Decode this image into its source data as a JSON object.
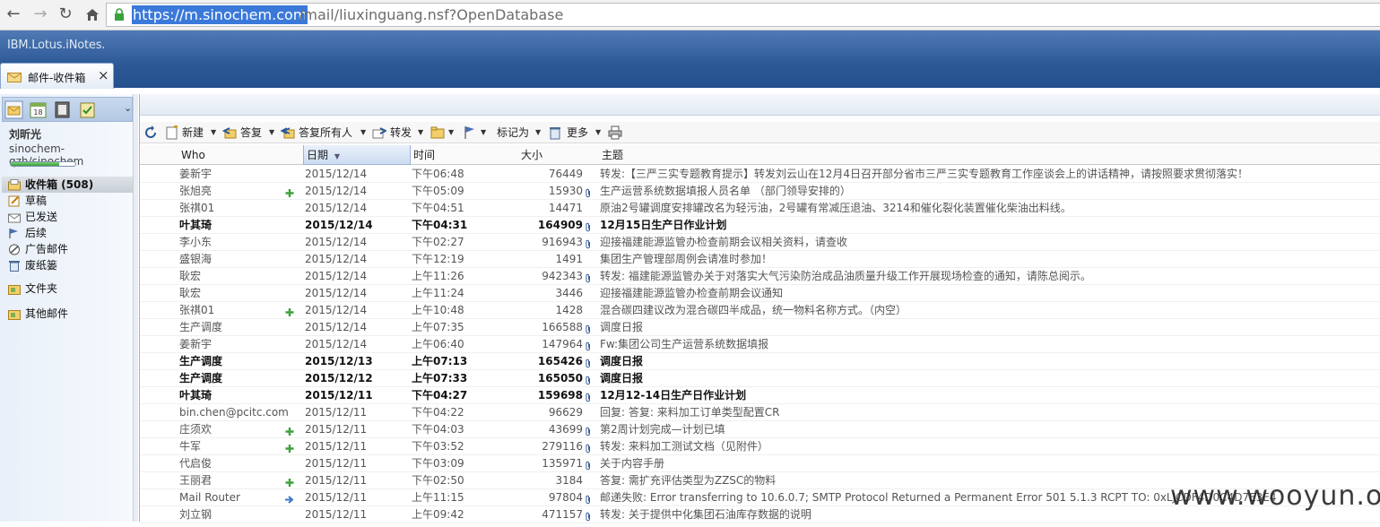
{
  "browser": {
    "url_host": "https://m.sinochem.com",
    "url_path": "/mail/liuxinguang.nsf?OpenDatabase"
  },
  "app": {
    "brand": "IBM.Lotus.iNotes.",
    "tab_label": "邮件-收件箱"
  },
  "user": {
    "name": "刘昕光",
    "mail_id": "sinochem-qzh/sinochem",
    "quota_fraction": 0.75
  },
  "folders": [
    {
      "label": "收件箱 (508)",
      "icon": "inbox-icon"
    },
    {
      "label": "草稿",
      "icon": "drafts-icon"
    },
    {
      "label": "已发送",
      "icon": "sent-icon"
    },
    {
      "label": "后续",
      "icon": "follow-up-flag-icon"
    },
    {
      "label": "广告邮件",
      "icon": "junk-icon"
    },
    {
      "label": "废纸篓",
      "icon": "trash-icon"
    },
    {
      "label": "文件夹",
      "icon": "folders-icon"
    },
    {
      "label": "其他邮件",
      "icon": "other-mail-icon"
    }
  ],
  "toolbar": {
    "new": "新建",
    "reply": "答复",
    "reply_all": "答复所有人",
    "forward": "转发",
    "mark_as": "标记为",
    "more": "更多"
  },
  "columns": {
    "who": "Who",
    "date": "日期",
    "time": "时间",
    "size": "大小",
    "subject": "主题"
  },
  "messages": [
    {
      "who": "姜新宇",
      "date": "2015/12/14",
      "time": "下午06:48",
      "size": "76449",
      "clip": false,
      "mark": "",
      "unread": false,
      "subject": "转发:【三严三实专题教育提示】转发刘云山在12月4日召开部分省市三严三实专题教育工作座谈会上的讲话精神，请按照要求贯彻落实！"
    },
    {
      "who": "张旭亮",
      "date": "2015/12/14",
      "time": "下午05:09",
      "size": "15930",
      "clip": true,
      "mark": "reply",
      "unread": false,
      "subject": "生产运营系统数据填报人员名单 （部门领导安排的）"
    },
    {
      "who": "张祺01",
      "date": "2015/12/14",
      "time": "下午04:51",
      "size": "14471",
      "clip": false,
      "mark": "",
      "unread": false,
      "subject": "原油2号罐调度安排罐改名为轻污油，2号罐有常减压退油、3214和催化裂化装置催化柴油出料线。"
    },
    {
      "who": "叶其琦",
      "date": "2015/12/14",
      "time": "下午04:31",
      "size": "164909",
      "clip": true,
      "mark": "",
      "unread": true,
      "subject": "12月15日生产日作业计划"
    },
    {
      "who": "李小东",
      "date": "2015/12/14",
      "time": "下午02:27",
      "size": "916943",
      "clip": true,
      "mark": "",
      "unread": false,
      "subject": "迎接福建能源监管办检查前期会议相关资料，请查收"
    },
    {
      "who": "盛银海",
      "date": "2015/12/14",
      "time": "下午12:19",
      "size": "1491",
      "clip": false,
      "mark": "",
      "unread": false,
      "subject": "集团生产管理部周例会请准时参加！"
    },
    {
      "who": "耿宏",
      "date": "2015/12/14",
      "time": "上午11:26",
      "size": "942343",
      "clip": true,
      "mark": "",
      "unread": false,
      "subject": "转发: 福建能源监管办关于对落实大气污染防治成品油质量升级工作开展现场检查的通知，请陈总阅示。"
    },
    {
      "who": "耿宏",
      "date": "2015/12/14",
      "time": "上午11:24",
      "size": "3446",
      "clip": false,
      "mark": "",
      "unread": false,
      "subject": "迎接福建能源监管办检查前期会议通知"
    },
    {
      "who": "张祺01",
      "date": "2015/12/14",
      "time": "上午10:48",
      "size": "1428",
      "clip": false,
      "mark": "reply",
      "unread": false,
      "subject": "混合碳四建议改为混合碳四半成品，统一物料名称方式。（内空）"
    },
    {
      "who": "生产调度",
      "date": "2015/12/14",
      "time": "上午07:35",
      "size": "166588",
      "clip": true,
      "mark": "",
      "unread": false,
      "subject": "调度日报"
    },
    {
      "who": "姜新宇",
      "date": "2015/12/14",
      "time": "上午06:40",
      "size": "147964",
      "clip": true,
      "mark": "",
      "unread": false,
      "subject": "Fw:集团公司生产运营系统数据填报"
    },
    {
      "who": "生产调度",
      "date": "2015/12/13",
      "time": "上午07:13",
      "size": "165426",
      "clip": true,
      "mark": "",
      "unread": true,
      "subject": "调度日报"
    },
    {
      "who": "生产调度",
      "date": "2015/12/12",
      "time": "上午07:33",
      "size": "165050",
      "clip": true,
      "mark": "",
      "unread": true,
      "subject": "调度日报"
    },
    {
      "who": "叶其琦",
      "date": "2015/12/11",
      "time": "下午04:27",
      "size": "159698",
      "clip": true,
      "mark": "",
      "unread": true,
      "subject": "12月12-14日生产日作业计划"
    },
    {
      "who": "bin.chen@pcitc.com",
      "date": "2015/12/11",
      "time": "下午04:22",
      "size": "96629",
      "clip": false,
      "mark": "",
      "unread": false,
      "subject": "回复: 答复: 来料加工订单类型配置CR"
    },
    {
      "who": "庄须欢",
      "date": "2015/12/11",
      "time": "下午04:03",
      "size": "43699",
      "clip": true,
      "mark": "reply",
      "unread": false,
      "subject": "第2周计划完成—计划已填"
    },
    {
      "who": "牛军",
      "date": "2015/12/11",
      "time": "下午03:52",
      "size": "279116",
      "clip": true,
      "mark": "reply",
      "unread": false,
      "subject": "转发: 来料加工测试文档（见附件）"
    },
    {
      "who": "代启俊",
      "date": "2015/12/11",
      "time": "下午03:09",
      "size": "135971",
      "clip": true,
      "mark": "",
      "unread": false,
      "subject": "关于内容手册"
    },
    {
      "who": "王丽君",
      "date": "2015/12/11",
      "time": "下午02:50",
      "size": "3184",
      "clip": false,
      "mark": "reply",
      "unread": false,
      "subject": "答复: 需扩充评估类型为ZZSC的物料"
    },
    {
      "who": "Mail Router",
      "date": "2015/12/11",
      "time": "上午11:15",
      "size": "97804",
      "clip": true,
      "mark": "forward",
      "unread": false,
      "subject": "邮递失败:  Error transferring to 10.6.0.7; SMTP Protocol Returned a Permanent Error 501 5.1.3 RCPT TO: 0xLJCDF4D0C4D7E3E4"
    },
    {
      "who": "刘立钢",
      "date": "2015/12/11",
      "time": "上午09:42",
      "size": "471157",
      "clip": true,
      "mark": "",
      "unread": false,
      "subject": "转发: 关于提供中化集团石油库存数据的说明"
    }
  ],
  "watermark": "www.wooyun.org"
}
